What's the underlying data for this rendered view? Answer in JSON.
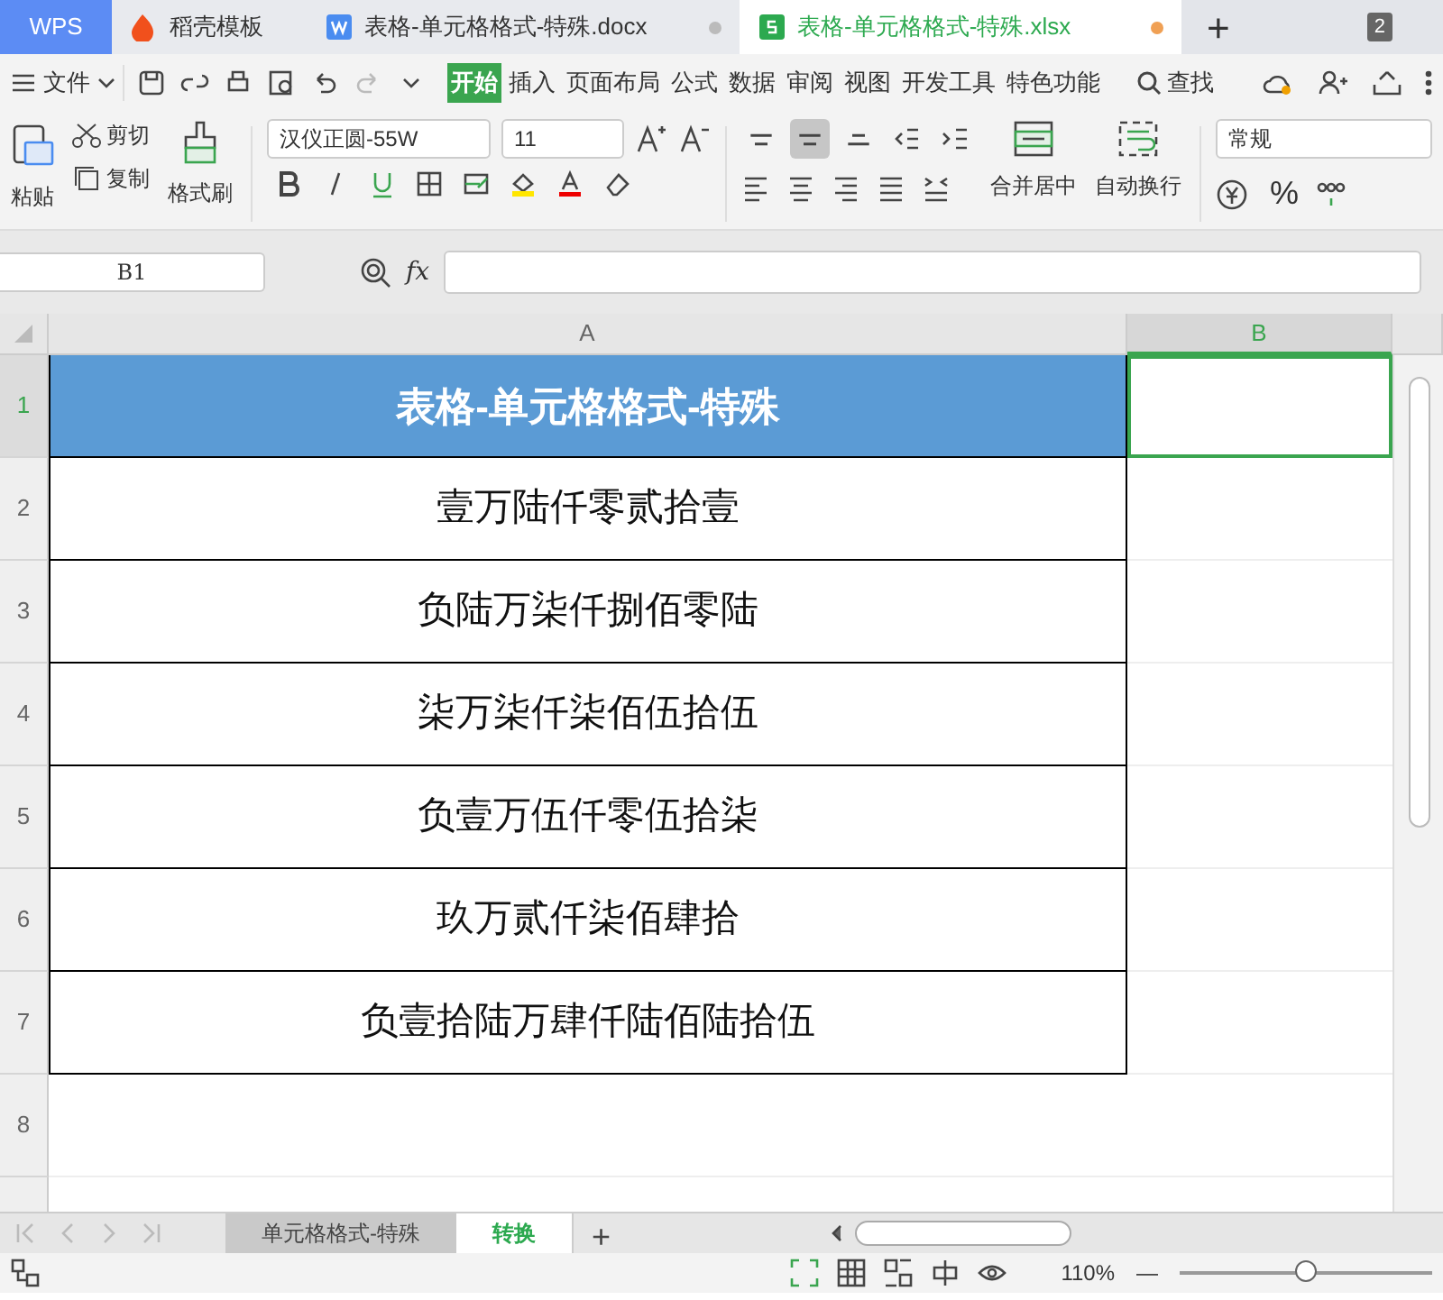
{
  "app_tabs": [
    {
      "label": "WPS",
      "kind": "home",
      "selected": false,
      "modified": false
    },
    {
      "label": "稻壳模板",
      "kind": "docer",
      "selected": false,
      "modified": false
    },
    {
      "label": "表格-单元格格式-特殊.docx",
      "kind": "writer",
      "selected": false,
      "modified": true
    },
    {
      "label": "表格-单元格格式-特殊.xlsx",
      "kind": "sheet",
      "selected": true,
      "modified": true
    }
  ],
  "new_tab": "+",
  "window_count": "2",
  "menu": {
    "file": "文件",
    "tabs": [
      {
        "label": "开始",
        "selected": true
      },
      {
        "label": "插入",
        "selected": false
      },
      {
        "label": "页面布局",
        "selected": false
      },
      {
        "label": "公式",
        "selected": false
      },
      {
        "label": "数据",
        "selected": false
      },
      {
        "label": "审阅",
        "selected": false
      },
      {
        "label": "视图",
        "selected": false
      },
      {
        "label": "开发工具",
        "selected": false
      },
      {
        "label": "特色功能",
        "selected": false
      }
    ],
    "search": "查找"
  },
  "ribbon": {
    "paste": "粘贴",
    "cut": "剪切",
    "copy": "复制",
    "format_painter": "格式刷",
    "font_name": "汉仪正圆-55W",
    "font_size": "11",
    "merge": "合并居中",
    "wrap": "自动换行",
    "number_format": "常规",
    "percent": "%",
    "align": [
      {
        "kind": "top",
        "selected": false
      },
      {
        "kind": "middle",
        "selected": true
      },
      {
        "kind": "bottom",
        "selected": false
      },
      {
        "kind": "outdent",
        "selected": false
      },
      {
        "kind": "indent",
        "selected": false
      }
    ]
  },
  "name_box": "B1",
  "fx": "fx",
  "columns": [
    {
      "label": "A",
      "selected": false
    },
    {
      "label": "B",
      "selected": true
    }
  ],
  "rows": [
    {
      "number": "1",
      "text": "表格-单元格格式-特殊",
      "kind": "title"
    },
    {
      "number": "2",
      "text": "壹万陆仟零贰拾壹",
      "kind": "value"
    },
    {
      "number": "3",
      "text": "负陆万柒仟捌佰零陆",
      "kind": "value"
    },
    {
      "number": "4",
      "text": "柒万柒仟柒佰伍拾伍",
      "kind": "value"
    },
    {
      "number": "5",
      "text": "负壹万伍仟零伍拾柒",
      "kind": "value"
    },
    {
      "number": "6",
      "text": "玖万贰仟柒佰肆拾",
      "kind": "value"
    },
    {
      "number": "7",
      "text": "负壹拾陆万肆仟陆佰陆拾伍",
      "kind": "value"
    },
    {
      "number": "8",
      "kind": "empty"
    }
  ],
  "sheets": [
    {
      "label": "单元格格式-特殊",
      "selected": false
    },
    {
      "label": "转换",
      "selected": true
    }
  ],
  "add_sheet": "+",
  "status": {
    "zoom": "110%",
    "zoom_minus": "—",
    "level": 0.5
  }
}
